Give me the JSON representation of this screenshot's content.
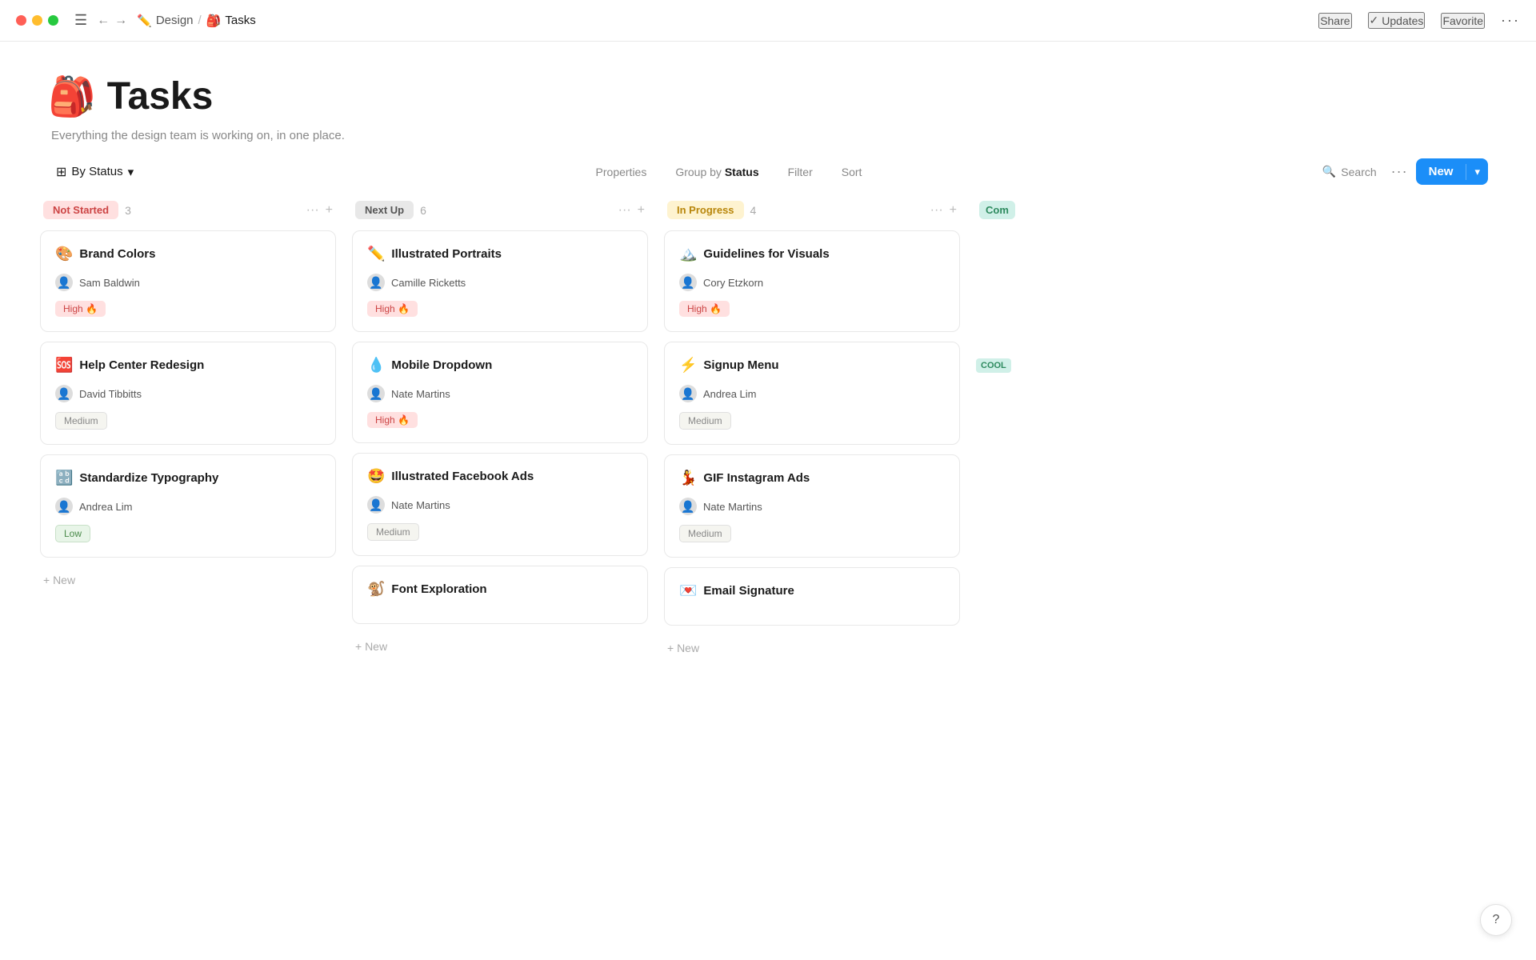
{
  "titlebar": {
    "breadcrumb_parent": "Design",
    "breadcrumb_child": "Tasks",
    "share_label": "Share",
    "updates_label": "Updates",
    "favorite_label": "Favorite"
  },
  "page": {
    "icon": "🎒",
    "title": "Tasks",
    "description": "Everything the design team is working on, in one place."
  },
  "toolbar": {
    "by_status_label": "By Status",
    "properties_label": "Properties",
    "group_by_label": "Group by",
    "group_by_value": "Status",
    "filter_label": "Filter",
    "sort_label": "Sort",
    "search_label": "Search",
    "new_label": "New"
  },
  "columns": [
    {
      "id": "not-started",
      "badge": "Not Started",
      "badge_class": "col-badge-not-started",
      "count": "3",
      "cards": [
        {
          "emoji": "🎨",
          "title": "Brand Colors",
          "assignee_avatar": "👤",
          "assignee": "Sam Baldwin",
          "priority": "High",
          "priority_class": "priority-high",
          "priority_icon": "🔥"
        },
        {
          "emoji": "🆘",
          "title": "Help Center Redesign",
          "assignee_avatar": "👤",
          "assignee": "David Tibbitts",
          "priority": "Medium",
          "priority_class": "priority-medium",
          "priority_icon": ""
        },
        {
          "emoji": "🔡",
          "title": "Standardize Typography",
          "assignee_avatar": "👤",
          "assignee": "Andrea Lim",
          "priority": "Low",
          "priority_class": "priority-low",
          "priority_icon": ""
        }
      ]
    },
    {
      "id": "next-up",
      "badge": "Next Up",
      "badge_class": "col-badge-next-up",
      "count": "6",
      "cards": [
        {
          "emoji": "✏️",
          "title": "Illustrated Portraits",
          "assignee_avatar": "👤",
          "assignee": "Camille Ricketts",
          "priority": "High",
          "priority_class": "priority-high",
          "priority_icon": "🔥"
        },
        {
          "emoji": "💧",
          "title": "Mobile Dropdown",
          "assignee_avatar": "👤",
          "assignee": "Nate Martins",
          "priority": "High",
          "priority_class": "priority-high",
          "priority_icon": "🔥"
        },
        {
          "emoji": "🤩",
          "title": "Illustrated Facebook Ads",
          "assignee_avatar": "👤",
          "assignee": "Nate Martins",
          "priority": "Medium",
          "priority_class": "priority-medium",
          "priority_icon": ""
        },
        {
          "emoji": "🐒",
          "title": "Font Exploration",
          "assignee_avatar": "👤",
          "assignee": "",
          "priority": "",
          "priority_class": "",
          "priority_icon": ""
        }
      ]
    },
    {
      "id": "in-progress",
      "badge": "In Progress",
      "badge_class": "col-badge-in-progress",
      "count": "4",
      "cards": [
        {
          "emoji": "🏔️",
          "title": "Guidelines for Visuals",
          "assignee_avatar": "👤",
          "assignee": "Cory Etzkorn",
          "priority": "High",
          "priority_class": "priority-high",
          "priority_icon": "🔥"
        },
        {
          "emoji": "⚡",
          "title": "Signup Menu",
          "assignee_avatar": "👤",
          "assignee": "Andrea Lim",
          "priority": "Medium",
          "priority_class": "priority-medium",
          "priority_icon": ""
        },
        {
          "emoji": "💃",
          "title": "GIF Instagram Ads",
          "assignee_avatar": "👤",
          "assignee": "Nate Martins",
          "priority": "Medium",
          "priority_class": "priority-medium",
          "priority_icon": ""
        },
        {
          "emoji": "💌",
          "title": "Email Signature",
          "assignee_avatar": "👤",
          "assignee": "",
          "priority": "",
          "priority_class": "",
          "priority_icon": ""
        }
      ]
    }
  ],
  "partial_column": {
    "badge": "Com",
    "cool_label": "COOL"
  },
  "add_new_label": "+ New",
  "help_label": "?"
}
